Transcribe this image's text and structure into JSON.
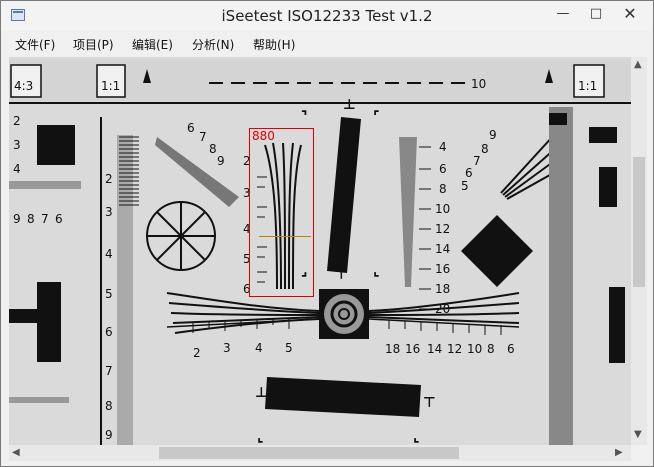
{
  "window": {
    "title": "iSeetest ISO12233 Test v1.2",
    "minimize_glyph": "—",
    "maximize_glyph": "□",
    "close_glyph": "✕"
  },
  "menu": [
    "文件(F)",
    "项目(P)",
    "编辑(E)",
    "分析(N)",
    "帮助(H)"
  ],
  "overlay": {
    "label": "880"
  },
  "chart_labels": {
    "ratio_left": "4:3",
    "ratio_mid": "1:1",
    "ratio_right": "1:1",
    "top_ruler_end": "10",
    "left_scale": [
      "2",
      "3",
      "4",
      "5",
      "6",
      "7",
      "8",
      "9"
    ],
    "wedge_small": [
      "6",
      "7",
      "8",
      "9"
    ],
    "left_edge": [
      "9",
      "8",
      "7",
      "6"
    ],
    "left_edge_top": [
      "2",
      "3",
      "4"
    ],
    "mid_wedge": [
      "2",
      "3",
      "4",
      "5",
      "6"
    ],
    "right_wedge": [
      "4",
      "6",
      "8",
      "10",
      "12",
      "14",
      "16",
      "18",
      "20"
    ],
    "right_small": [
      "9",
      "8",
      "7",
      "6",
      "5"
    ],
    "bottom_ruler_left": [
      "2",
      "3",
      "4",
      "5"
    ],
    "bottom_ruler_right": [
      "18",
      "16",
      "14",
      "12",
      "10",
      "8",
      "6"
    ]
  },
  "icons": {
    "app": "app-window-icon",
    "minimize": "minimize-icon",
    "maximize": "maximize-icon",
    "close": "close-icon",
    "scroll_up": "scroll-up-arrow-icon",
    "scroll_down": "scroll-down-arrow-icon",
    "scroll_left": "scroll-left-arrow-icon",
    "scroll_right": "scroll-right-arrow-icon"
  },
  "colors": {
    "overlay": "#e00000",
    "midline": "#c08000"
  }
}
